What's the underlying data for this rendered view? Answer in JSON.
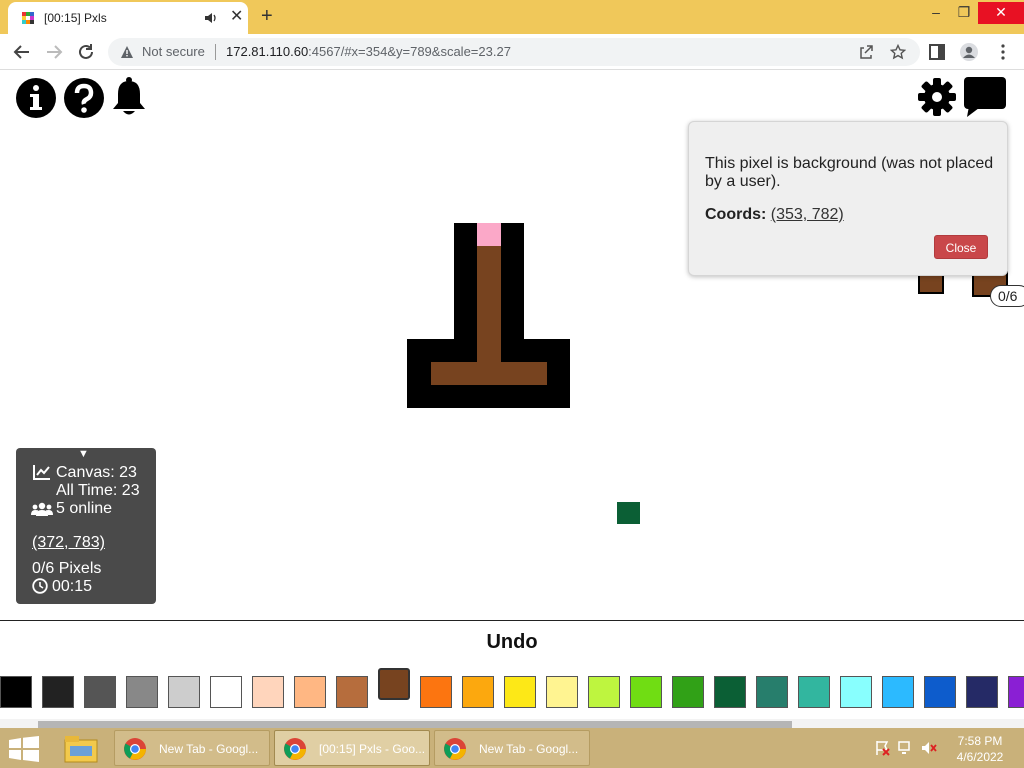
{
  "browser": {
    "tab_title": "[00:15] Pxls",
    "not_secure_label": "Not secure",
    "url_host": "172.81.110.60",
    "url_rest": ":4567/#x=354&y=789&scale=23.27"
  },
  "popup": {
    "message": "This pixel is background (was not placed by a user).",
    "coords_label": "Coords:",
    "coords_value": "(353, 782)",
    "close_label": "Close"
  },
  "pixel_bubble": "0/6",
  "info_panel": {
    "canvas_line": "Canvas: 23",
    "alltime_line": "All Time: 23",
    "online_line": "5 online",
    "cursor_coords": "(372, 783)",
    "pixels_line": "0/6 Pixels",
    "timer": "00:15"
  },
  "bottom": {
    "undo_label": "Undo"
  },
  "palette": [
    "#000000",
    "#222222",
    "#555555",
    "#888888",
    "#cdcdcd",
    "#ffffff",
    "#ffd5bc",
    "#ffb783",
    "#b66d3d",
    "#77431f",
    "#fc7510",
    "#fca80e",
    "#fde817",
    "#fff491",
    "#bef53f",
    "#70dd13",
    "#31a117",
    "#0b5f35",
    "#277e6c",
    "#32b69f",
    "#88fffe",
    "#2cbaff",
    "#0d5ccc",
    "#252a66",
    "#8a1fd4"
  ],
  "palette_selected_index": 9,
  "taskbar": {
    "items": [
      "New Tab - Googl...",
      "[00:15] Pxls - Goo...",
      "New Tab - Googl..."
    ],
    "time": "7:58 PM",
    "date": "4/6/2022"
  }
}
